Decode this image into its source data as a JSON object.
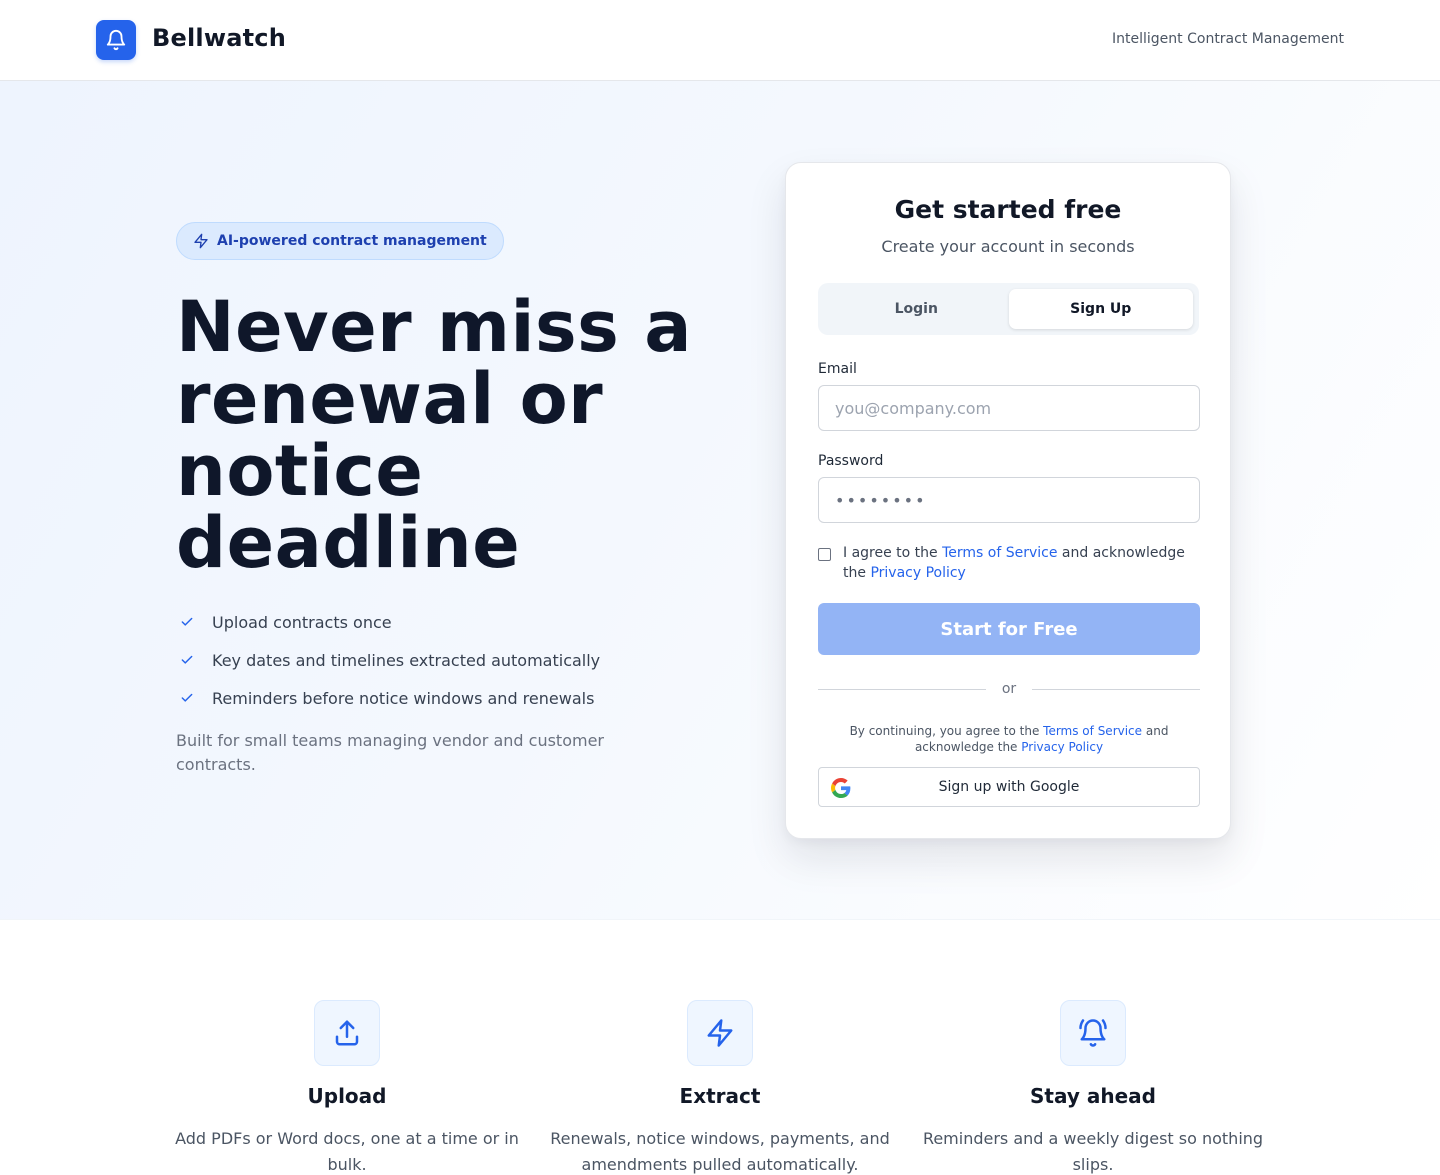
{
  "header": {
    "brand": "Bellwatch",
    "tagline": "Intelligent Contract Management",
    "logo_icon": "bell-icon"
  },
  "hero": {
    "pill_label": "AI-powered contract management",
    "pill_icon": "lightning-icon",
    "headline_lines": [
      "Never miss a",
      "renewal or",
      "notice",
      "deadline"
    ],
    "features": [
      "Upload contracts once",
      "Key dates and timelines extracted automatically",
      "Reminders before notice windows and renewals"
    ],
    "built_for": "Built for small teams managing vendor and customer contracts."
  },
  "signup": {
    "title": "Get started free",
    "subtitle": "Create your account in seconds",
    "tabs": [
      {
        "label": "Login",
        "active": false
      },
      {
        "label": "Sign Up",
        "active": true
      }
    ],
    "email_label": "Email",
    "email_placeholder": "you@company.com",
    "password_label": "Password",
    "password_value": "••••••••",
    "agree_prefix": "I agree to the ",
    "agree_terms": "Terms of Service",
    "agree_middle": " and acknowledge the ",
    "agree_privacy": "Privacy Policy",
    "submit_label": "Start for Free",
    "divider_label": "or",
    "legal_prefix": "By continuing, you agree to the ",
    "legal_terms": "Terms of Service",
    "legal_middle": " and acknowledge the ",
    "legal_privacy": "Privacy Policy",
    "google_label": "Sign up with Google"
  },
  "feature_cards": [
    {
      "icon": "upload-icon",
      "title": "Upload",
      "description": "Add PDFs or Word docs, one at a time or in bulk."
    },
    {
      "icon": "lightning-icon",
      "title": "Extract",
      "description": "Renewals, notice windows, payments, and amendments pulled automatically."
    },
    {
      "icon": "bell-ring-icon",
      "title": "Stay ahead",
      "description": "Reminders and a weekly digest so nothing slips."
    }
  ],
  "colors": {
    "accent": "#2563eb",
    "primary_button_disabled": "#93b4f5",
    "pill_bg": "#dbeafe",
    "pill_text": "#1e40af"
  }
}
